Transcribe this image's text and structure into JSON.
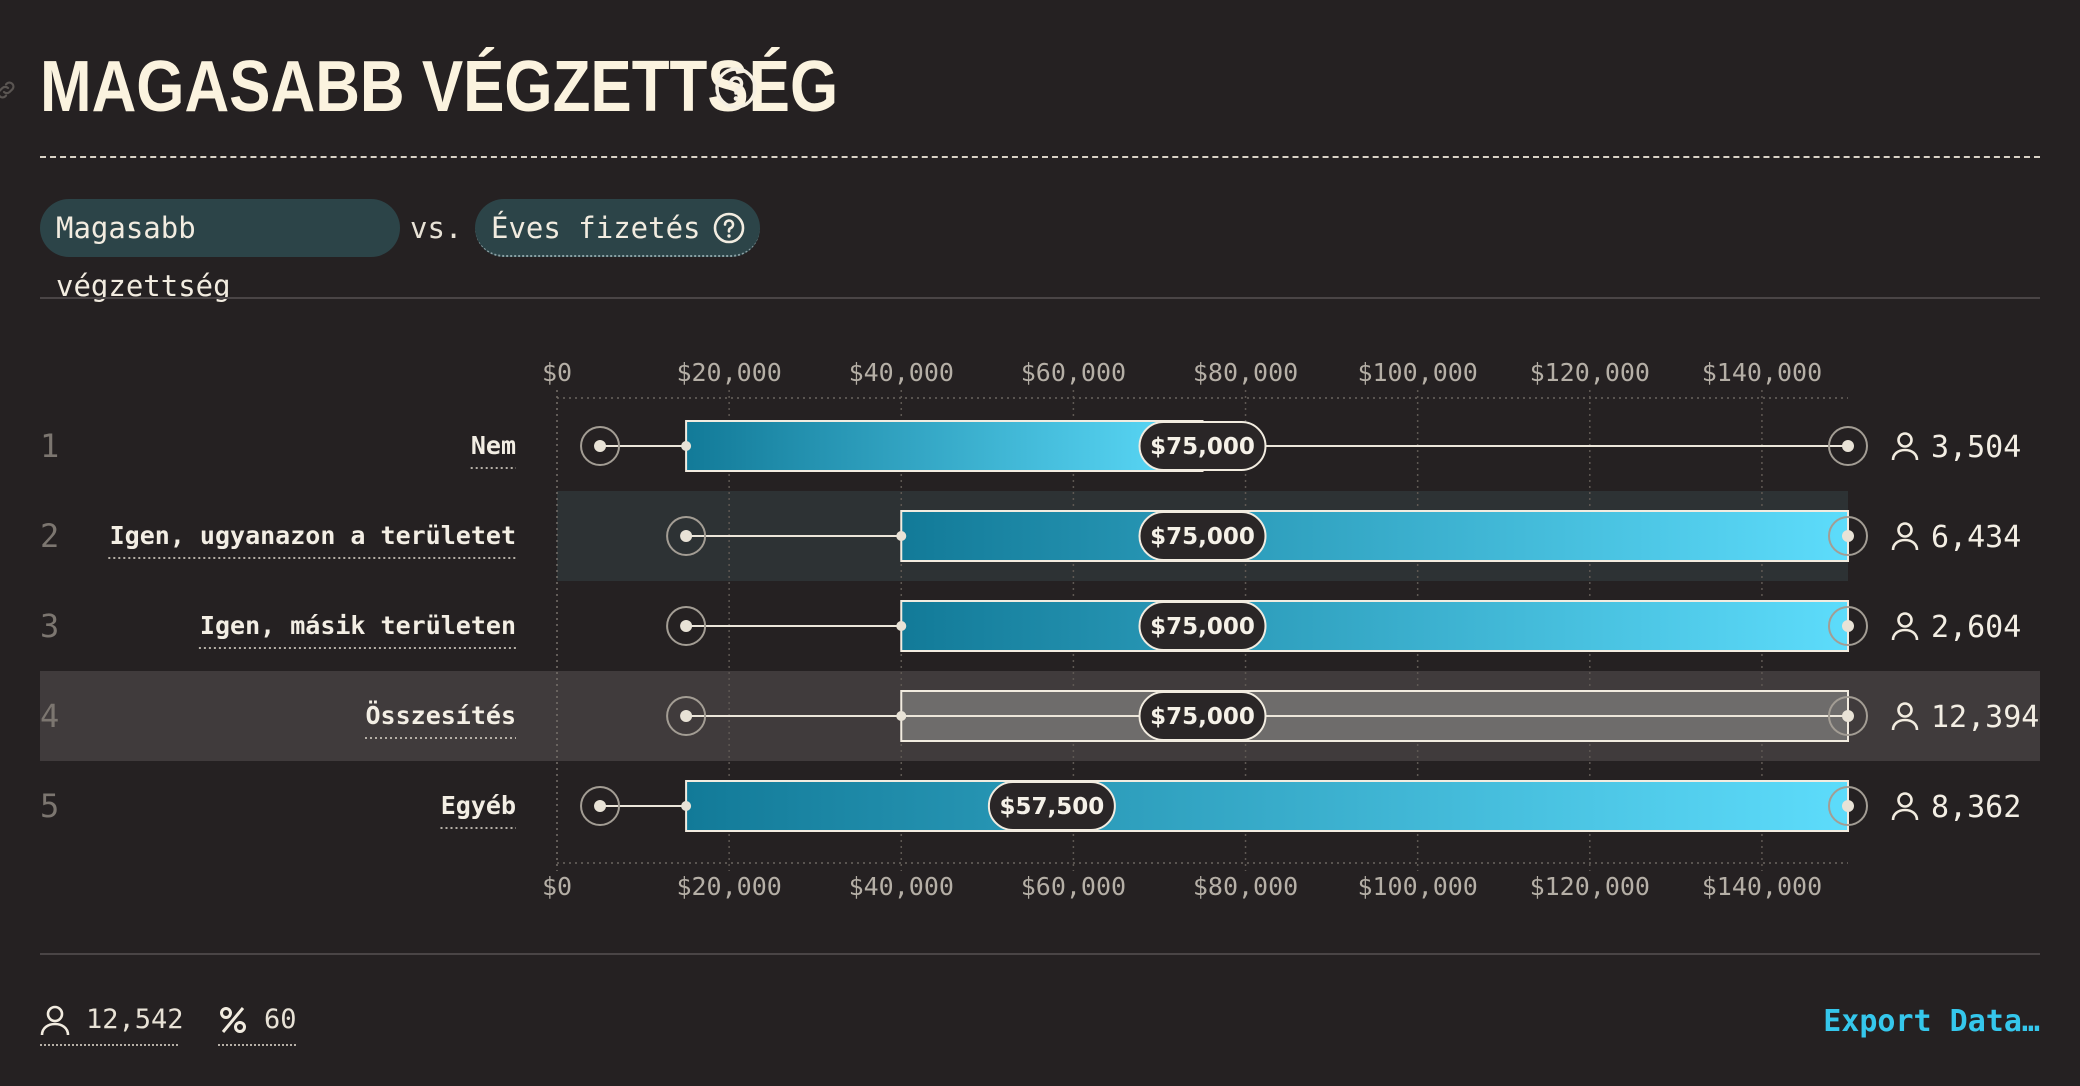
{
  "header": {
    "title": "MAGASABB VÉGZETTSÉG",
    "help_icon": "question-circle-icon",
    "link_icon": "link-icon"
  },
  "comparison": {
    "left_label": "Magasabb végzettség",
    "vs_label": "vs.",
    "right_label": "Éves fizetés"
  },
  "colors": {
    "background": "#252122",
    "bar_gradient_start": "#127a98",
    "bar_gradient_end": "#5ddcfb",
    "total_bar": "#6e6c6b",
    "highlight_row": "#2d3234",
    "total_row": "#403b3c",
    "accent": "#35c7ec"
  },
  "chart_data": {
    "type": "box",
    "x_ticks": [
      "$0",
      "$20,000",
      "$40,000",
      "$60,000",
      "$80,000",
      "$100,000",
      "$120,000",
      "$140,000"
    ],
    "xlim": [
      0,
      150000
    ],
    "rows": [
      {
        "rank": "1",
        "label": "Nem",
        "whisker_low": 5000,
        "q1": 15000,
        "median": 75000,
        "q3": 75000,
        "whisker_high": 150000,
        "median_label": "$75,000",
        "count": "3,504",
        "highlight": false,
        "total": false
      },
      {
        "rank": "2",
        "label": "Igen, ugyanazon a területet",
        "whisker_low": 15000,
        "q1": 40000,
        "median": 75000,
        "q3": 150000,
        "whisker_high": 150000,
        "median_label": "$75,000",
        "count": "6,434",
        "highlight": true,
        "total": false
      },
      {
        "rank": "3",
        "label": "Igen, másik területen",
        "whisker_low": 15000,
        "q1": 40000,
        "median": 75000,
        "q3": 150000,
        "whisker_high": 150000,
        "median_label": "$75,000",
        "count": "2,604",
        "highlight": false,
        "total": false
      },
      {
        "rank": "4",
        "label": "Összesítés",
        "whisker_low": 15000,
        "q1": 40000,
        "median": 75000,
        "q3": 150000,
        "whisker_high": 150000,
        "median_label": "$75,000",
        "count": "12,394",
        "highlight": false,
        "total": true
      },
      {
        "rank": "5",
        "label": "Egyéb",
        "whisker_low": 5000,
        "q1": 15000,
        "median": 57500,
        "q3": 150000,
        "whisker_high": 150000,
        "median_label": "$57,500",
        "count": "8,362",
        "highlight": false,
        "total": false
      }
    ]
  },
  "footer": {
    "respondents": "12,542",
    "percent": "60",
    "export_label": "Export Data…"
  }
}
